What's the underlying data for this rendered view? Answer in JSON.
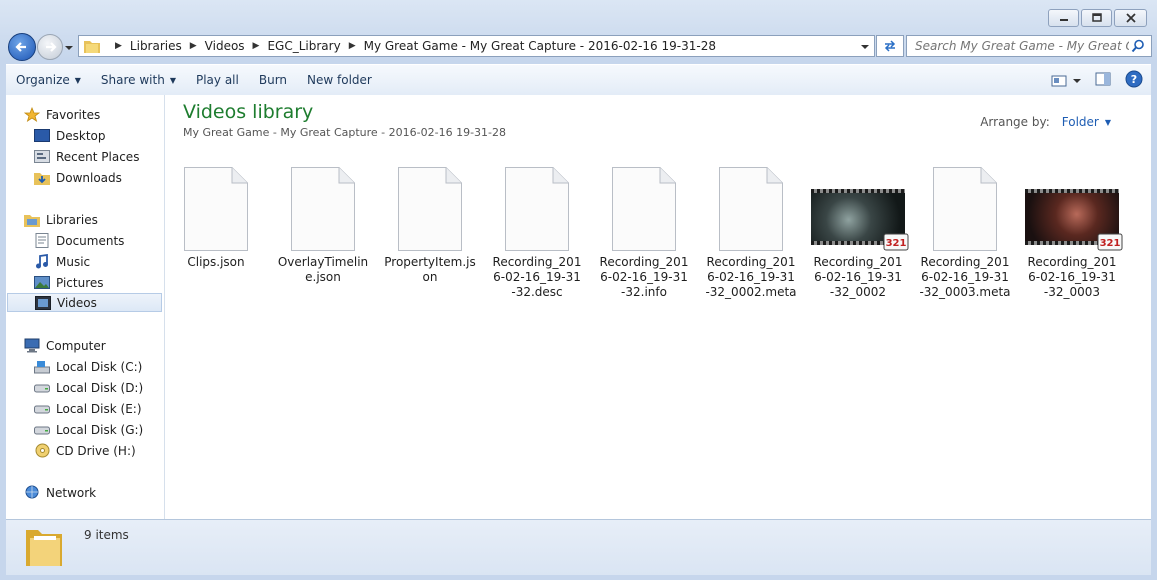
{
  "window": {
    "minimize": "minimize",
    "maximize": "maximize",
    "close": "close"
  },
  "address": {
    "crumbs": [
      "Libraries",
      "Videos",
      "EGC_Library",
      "My Great Game - My Great Capture - 2016-02-16 19-31-28"
    ],
    "search_placeholder": "Search My Great Game - My Great Ca..."
  },
  "toolbar": {
    "organize": "Organize",
    "share_with": "Share with",
    "play_all": "Play all",
    "burn": "Burn",
    "new_folder": "New folder"
  },
  "nav": {
    "favorites": "Favorites",
    "desktop": "Desktop",
    "recent_places": "Recent Places",
    "downloads": "Downloads",
    "libraries": "Libraries",
    "documents": "Documents",
    "music": "Music",
    "pictures": "Pictures",
    "videos": "Videos",
    "computer": "Computer",
    "disk_c": "Local Disk (C:)",
    "disk_d": "Local Disk (D:)",
    "disk_e": "Local Disk (E:)",
    "disk_g": "Local Disk (G:)",
    "cd_h": "CD Drive (H:)",
    "network": "Network"
  },
  "content": {
    "title": "Videos library",
    "subtitle": "My Great Game - My Great Capture - 2016-02-16 19-31-28",
    "arrange_label": "Arrange by:",
    "arrange_value": "Folder",
    "files": [
      {
        "name": "Clips.json",
        "kind": "doc"
      },
      {
        "name": "OverlayTimeline.json",
        "kind": "doc"
      },
      {
        "name": "PropertyItem.json",
        "kind": "doc"
      },
      {
        "name": "Recording_2016-02-16_19-31-32.desc",
        "kind": "doc"
      },
      {
        "name": "Recording_2016-02-16_19-31-32.info",
        "kind": "doc"
      },
      {
        "name": "Recording_2016-02-16_19-31-32_0002.meta",
        "kind": "doc"
      },
      {
        "name": "Recording_2016-02-16_19-31-32_0002",
        "kind": "video"
      },
      {
        "name": "Recording_2016-02-16_19-31-32_0003.meta",
        "kind": "doc"
      },
      {
        "name": "Recording_2016-02-16_19-31-32_0003",
        "kind": "video"
      }
    ]
  },
  "details": {
    "count": "9 items"
  },
  "colors": {
    "library_title": "#1e7d2f",
    "link_blue": "#1e5db3",
    "badge_text": "321"
  }
}
